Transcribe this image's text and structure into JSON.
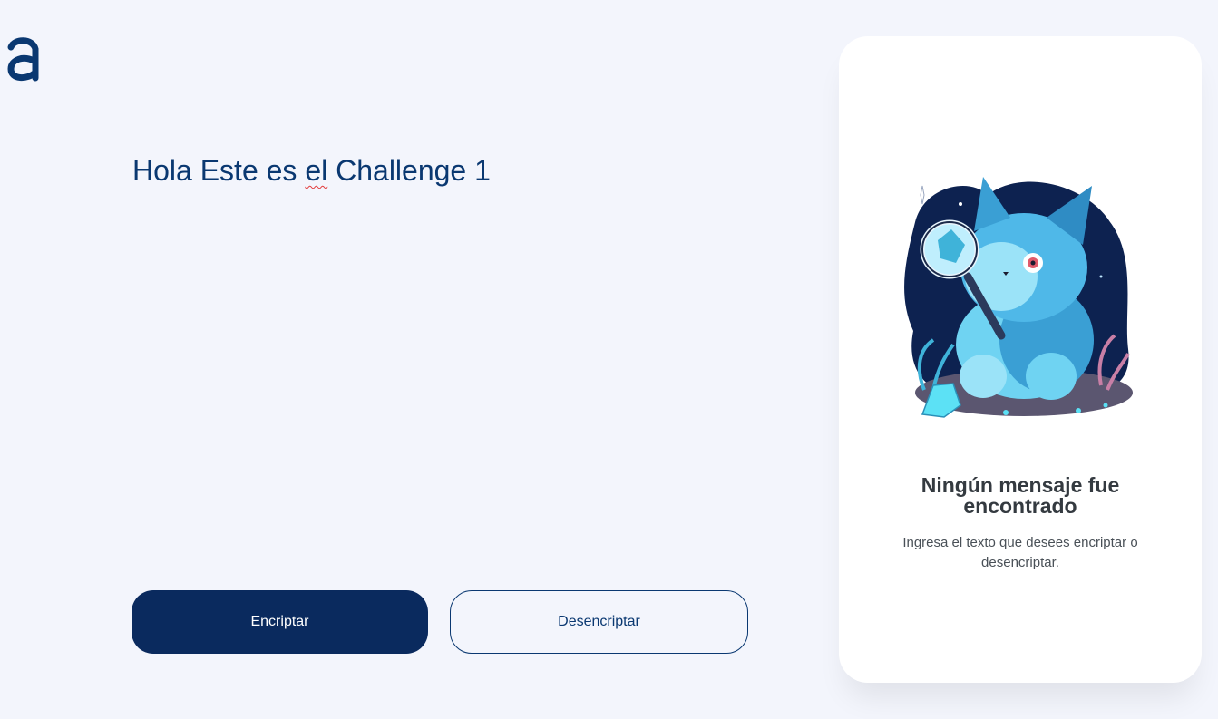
{
  "logo": {
    "icon": "alura-a-logo-icon",
    "color": "#0a3871"
  },
  "editor": {
    "text_before": "Hola Este es ",
    "text_misspelled": "el",
    "text_after": " Challenge 1"
  },
  "buttons": {
    "encrypt_label": "Encriptar",
    "decrypt_label": "Desencriptar"
  },
  "result_panel": {
    "illustration": "cat-with-magnifying-glass-illustration",
    "title": "Ningún mensaje fue encontrado",
    "description": "Ingresa el texto que desees encriptar o desencriptar."
  },
  "colors": {
    "background": "#f3f5fc",
    "primary": "#0a3871",
    "primary_button": "#0a2a5e",
    "panel": "#ffffff"
  }
}
